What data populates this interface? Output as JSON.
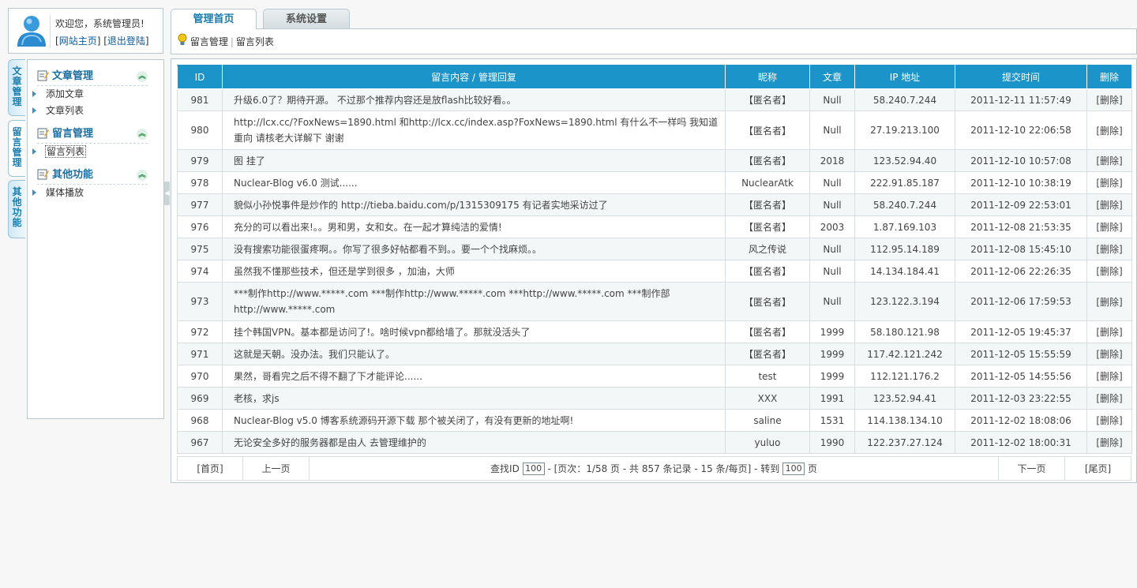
{
  "user": {
    "welcome": "欢迎您，系统管理员!",
    "home_link": "网站主页",
    "logout_link": "退出登陆"
  },
  "side_tabs": [
    {
      "label": [
        "文",
        "章",
        "管",
        "理"
      ]
    },
    {
      "label": [
        "留",
        "言",
        "管",
        "理"
      ]
    },
    {
      "label": [
        "其",
        "他",
        "功",
        "能"
      ]
    }
  ],
  "menu": {
    "sections": [
      {
        "title": "文章管理",
        "items": [
          "添加文章",
          "文章列表"
        ]
      },
      {
        "title": "留言管理",
        "items": [
          "留言列表"
        ]
      },
      {
        "title": "其他功能",
        "items": [
          "媒体播放"
        ]
      }
    ],
    "active_item": "留言列表"
  },
  "top_tabs": {
    "home": "管理首页",
    "settings": "系统设置"
  },
  "breadcrumb": {
    "section": "留言管理",
    "page": "留言列表"
  },
  "table": {
    "headers": [
      "ID",
      "留言内容 / 管理回复",
      "昵称",
      "文章",
      "IP 地址",
      "提交时间",
      "删除"
    ],
    "rows": [
      {
        "id": "981",
        "msg": "升级6.0了？期待开源。 不过那个推荐内容还是放flash比较好看。。",
        "nick": "【匿名者】",
        "article": "Null",
        "ip": "58.240.7.244",
        "time": "2011-12-11 11:57:49",
        "del": "[删除]"
      },
      {
        "id": "980",
        "msg": "http://lcx.cc/?FoxNews=1890.html 和http://lcx.cc/index.asp?FoxNews=1890.html 有什么不一样吗 我知道重向 请核老大详解下 谢谢",
        "nick": "【匿名者】",
        "article": "Null",
        "ip": "27.19.213.100",
        "time": "2011-12-10 22:06:58",
        "del": "[删除]"
      },
      {
        "id": "979",
        "msg": "图 挂了",
        "nick": "【匿名者】",
        "article": "2018",
        "ip": "123.52.94.40",
        "time": "2011-12-10 10:57:08",
        "del": "[删除]"
      },
      {
        "id": "978",
        "msg": "Nuclear-Blog v6.0 测试......",
        "nick": "NuclearAtk",
        "article": "Null",
        "ip": "222.91.85.187",
        "time": "2011-12-10 10:38:19",
        "del": "[删除]"
      },
      {
        "id": "977",
        "msg": "貌似小孙悦事件是炒作的 http://tieba.baidu.com/p/1315309175 有记者实地采访过了",
        "nick": "【匿名者】",
        "article": "Null",
        "ip": "58.240.7.244",
        "time": "2011-12-09 22:53:01",
        "del": "[删除]"
      },
      {
        "id": "976",
        "msg": "充分的可以看出来!。。男和男，女和女。在一起才算纯洁的爱情!",
        "nick": "【匿名者】",
        "article": "2003",
        "ip": "1.87.169.103",
        "time": "2011-12-08 21:53:35",
        "del": "[删除]"
      },
      {
        "id": "975",
        "msg": "没有搜索功能很蛋疼啊。。你写了很多好帖都看不到。。要一个个找麻烦。。",
        "nick": "风之传说",
        "article": "Null",
        "ip": "112.95.14.189",
        "time": "2011-12-08 15:45:10",
        "del": "[删除]"
      },
      {
        "id": "974",
        "msg": "虽然我不懂那些技术，但还是学到很多 ，加油，大师",
        "nick": "【匿名者】",
        "article": "Null",
        "ip": "14.134.184.41",
        "time": "2011-12-06 22:26:35",
        "del": "[删除]"
      },
      {
        "id": "973",
        "msg": "***制作http://www.*****.com ***制作http://www.*****.com ***http://www.*****.com ***制作部http://www.*****.com",
        "nick": "【匿名者】",
        "article": "Null",
        "ip": "123.122.3.194",
        "time": "2011-12-06 17:59:53",
        "del": "[删除]"
      },
      {
        "id": "972",
        "msg": "挂个韩国VPN。基本都是访问了!。啥时候vpn都给墙了。那就没活头了",
        "nick": "【匿名者】",
        "article": "1999",
        "ip": "58.180.121.98",
        "time": "2011-12-05 19:45:37",
        "del": "[删除]"
      },
      {
        "id": "971",
        "msg": "这就是天朝。没办法。我们只能认了。",
        "nick": "【匿名者】",
        "article": "1999",
        "ip": "117.42.121.242",
        "time": "2011-12-05 15:55:59",
        "del": "[删除]"
      },
      {
        "id": "970",
        "msg": "果然，哥看完之后不得不翻了下才能评论......",
        "nick": "test",
        "article": "1999",
        "ip": "112.121.176.2",
        "time": "2011-12-05 14:55:56",
        "del": "[删除]"
      },
      {
        "id": "969",
        "msg": "老核，求js",
        "nick": "XXX",
        "article": "1991",
        "ip": "123.52.94.41",
        "time": "2011-12-03 23:22:55",
        "del": "[删除]"
      },
      {
        "id": "968",
        "msg": "Nuclear-Blog v5.0 博客系统源码开源下载 那个被关闭了，有没有更新的地址啊!",
        "nick": "saline",
        "article": "1531",
        "ip": "114.138.134.10",
        "time": "2011-12-02 18:08:06",
        "del": "[删除]"
      },
      {
        "id": "967",
        "msg": "无论安全多好的服务器都是由人 去管理维护的",
        "nick": "yuluo",
        "article": "1990",
        "ip": "122.237.27.124",
        "time": "2011-12-02 18:00:31",
        "del": "[删除]"
      }
    ]
  },
  "pager": {
    "first": "[首页]",
    "prev": "上一页",
    "find_label": "查找ID",
    "find_value": "100",
    "info": "- [页次：1/58 页 - 共 857 条记录 - 15 条/每页] - 转到",
    "goto_value": "100",
    "page_unit": "页",
    "next": "下一页",
    "last": "[尾页]"
  },
  "colors": {
    "header_bg": "#1a94c9",
    "accent": "#1a7db0"
  }
}
